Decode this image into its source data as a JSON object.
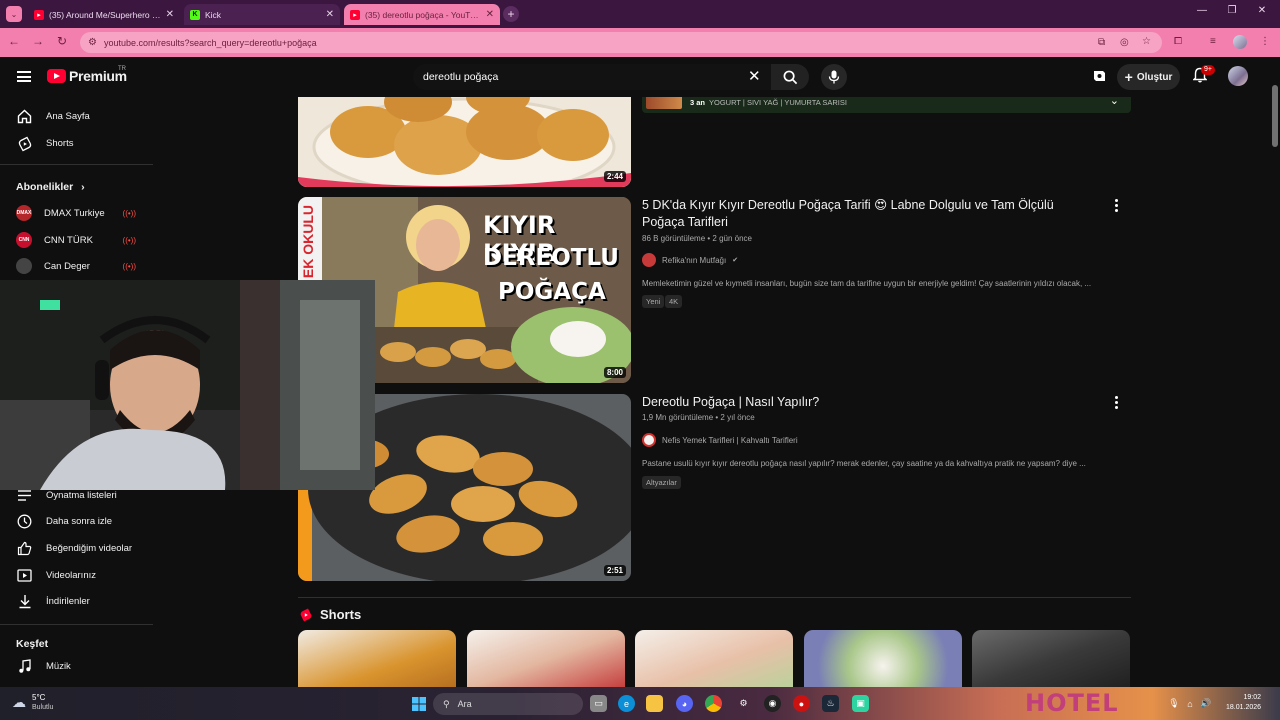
{
  "browser": {
    "tabs": [
      {
        "title": "(35) Around Me/Superhero - M",
        "favicon": "youtube-icon"
      },
      {
        "title": "Kick",
        "favicon": "kick-icon"
      },
      {
        "title": "(35) dereotlu poğaça - YouTube",
        "favicon": "youtube-icon",
        "active": true
      }
    ],
    "url": "youtube.com/results?search_query=dereotlu+poğaça",
    "accent": "#f27fae"
  },
  "youtube": {
    "logo_text": "Premium",
    "logo_sup": "TR",
    "search_value": "dereotlu poğaça",
    "create_label": "Oluştur",
    "notifications_badge": "9+"
  },
  "sidebar": {
    "home": "Ana Sayfa",
    "shorts": "Shorts",
    "subscriptions_header": "Abonelikler",
    "channels": [
      {
        "name": "DMAX Turkiye",
        "live": true,
        "avatar_text": "DMAX",
        "color": "#b3262a"
      },
      {
        "name": "CNN TÜRK",
        "live": true,
        "avatar_text": "CNN",
        "color": "#c8102e"
      },
      {
        "name": "Can Deger",
        "live": true,
        "avatar_text": "",
        "color": "#333333"
      }
    ],
    "playlists": "Oynatma listeleri",
    "watch_later": "Daha sonra izle",
    "liked": "Beğendiğim videolar",
    "your_videos": "Videolarınız",
    "downloads": "İndirilenler",
    "explore_header": "Keşfet",
    "music": "Müzik"
  },
  "results": {
    "chapter_strip": {
      "time": "3 an",
      "text": "YOGURT | SIVI YAĞ | YUMURTA SARISI"
    },
    "videos": [
      {
        "duration": "2:44"
      },
      {
        "title": "5 DK'da Kıyır Kıyır Dereotlu Poğaça Tarifi 😍 Labne Dolgulu ve Tam Ölçülü Poğaça Tarifleri",
        "meta": "86 B görüntüleme • 2 gün önce",
        "channel": "Refika'nın Mutfağı",
        "verified": true,
        "description": "Memleketimin güzel ve kıymetli insanları, bugün size tam da tarifine uygun bir enerjiyle geldim! Çay saatlerinin yıldızı olacak, ...",
        "badges": [
          "Yeni",
          "4K"
        ],
        "duration": "8:00",
        "thumb_text_1": "KIYIR KIYIR",
        "thumb_text_2": "DEREOTLU",
        "thumb_text_3": "POĞAÇA",
        "thumb_side_text": "EK OKULU"
      },
      {
        "title": "Dereotlu Poğaça | Nasıl Yapılır?",
        "meta": "1,9 Mn görüntüleme • 2 yıl önce",
        "channel": "Nefis Yemek Tarifleri | Kahvaltı Tarifleri",
        "description": "Pastane usulü kıyır kıyır dereotlu poğaça nasıl yapılır? merak edenler, çay saatine ya da kahvaltıya pratik ne yapsam? diye ...",
        "badges": [
          "Altyazılar"
        ],
        "duration": "2:51"
      }
    ],
    "shorts_header": "Shorts"
  },
  "taskbar": {
    "temperature": "5°C",
    "weather": "Bulutlu",
    "search_placeholder": "Ara",
    "time": "19:02",
    "date": "18.01.2026",
    "wallpaper_text": "HOTEL"
  }
}
